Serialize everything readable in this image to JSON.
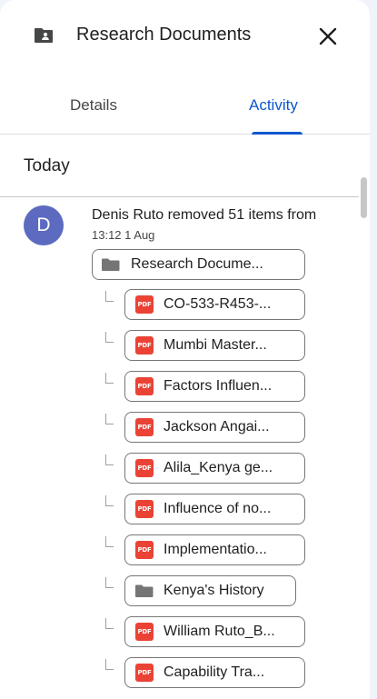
{
  "header": {
    "title": "Research Documents",
    "folder_icon": "shared-folder-icon",
    "close_icon": "close-icon"
  },
  "tabs": [
    {
      "label": "Details",
      "active": false
    },
    {
      "label": "Activity",
      "active": true
    }
  ],
  "section": {
    "title": "Today"
  },
  "activity": {
    "avatar_letter": "D",
    "avatar_color": "#5c6bc0",
    "text": "Denis Ruto removed 51 items from",
    "time": "13:12 1 Aug",
    "parent": {
      "label": "Research Docume...",
      "type": "folder"
    },
    "items": [
      {
        "label": "CO-533-R453-...",
        "type": "pdf"
      },
      {
        "label": "Mumbi Master...",
        "type": "pdf"
      },
      {
        "label": "Factors Influen...",
        "type": "pdf"
      },
      {
        "label": "Jackson Angai...",
        "type": "pdf"
      },
      {
        "label": "Alila_Kenya ge...",
        "type": "pdf"
      },
      {
        "label": "Influence of no...",
        "type": "pdf"
      },
      {
        "label": "Implementatio...",
        "type": "pdf"
      },
      {
        "label": "Kenya's History",
        "type": "folder"
      },
      {
        "label": "William Ruto_B...",
        "type": "pdf"
      },
      {
        "label": "Capability Tra...",
        "type": "pdf"
      }
    ]
  },
  "icons": {
    "pdf_text": "PDF"
  },
  "colors": {
    "accent": "#0b57d0",
    "pdf_red": "#ea4335",
    "folder_grey": "#757575"
  }
}
